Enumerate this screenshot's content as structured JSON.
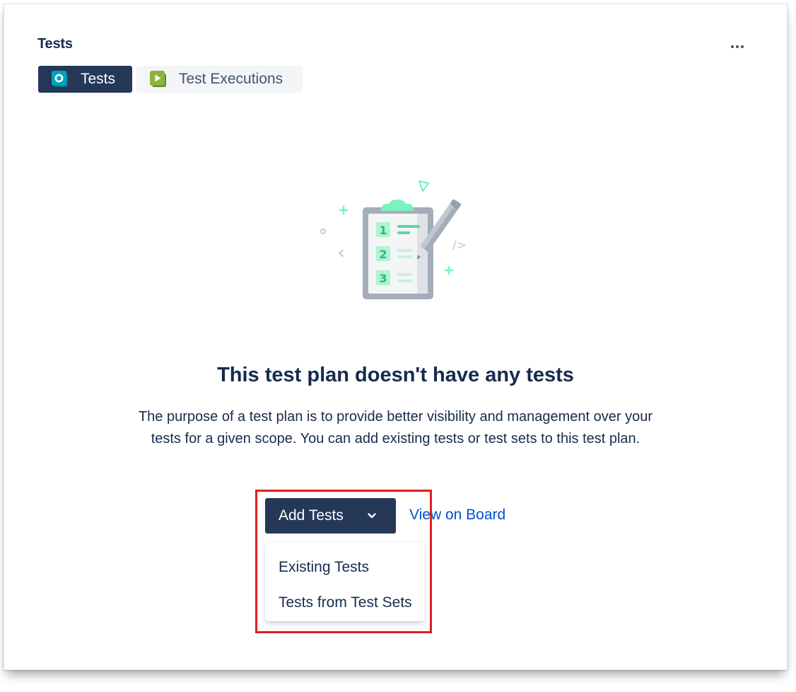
{
  "panel": {
    "title": "Tests",
    "more_icon": "more-horizontal-icon"
  },
  "tabs": [
    {
      "label": "Tests",
      "icon": "test-icon",
      "active": true,
      "icon_color": "#00a3bf"
    },
    {
      "label": "Test Executions",
      "icon": "test-execution-icon",
      "active": false,
      "icon_color": "#8db33a"
    }
  ],
  "empty_state": {
    "illustration": {
      "icon": "clipboard-checklist-illustration",
      "numbers": [
        "1",
        "2",
        "3"
      ],
      "code_glyph": "/>"
    },
    "heading": "This test plan doesn't have any tests",
    "description": "The purpose of a test plan is to provide better visibility and management over your tests for a given scope. You can add existing tests or test sets to this test plan."
  },
  "actions": {
    "add_tests_label": "Add Tests",
    "add_tests_icon": "chevron-down-icon",
    "view_on_board_label": "View on Board"
  },
  "dropdown": {
    "items": [
      "Existing Tests",
      "Tests from Test Sets"
    ]
  },
  "colors": {
    "primary": "#253858",
    "link": "#0052cc",
    "highlight": "#e01e22",
    "text": "#172b4d"
  }
}
